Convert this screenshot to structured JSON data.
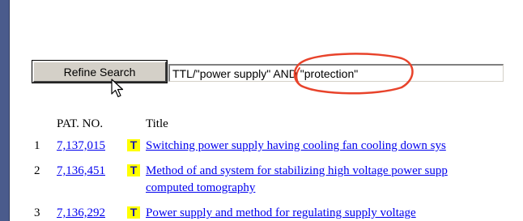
{
  "search": {
    "refine_button_label": "Refine Search",
    "query_value": "TTL/\"power supply\" AND \"protection\""
  },
  "results": {
    "headers": {
      "pat_no": "PAT. NO.",
      "title": "Title"
    },
    "rows": [
      {
        "num": "1",
        "pat_no": "7,137,015",
        "icon": "T",
        "title": "Switching power supply having cooling fan cooling down sys"
      },
      {
        "num": "2",
        "pat_no": "7,136,451",
        "icon": "T",
        "title": "Method of and system for stabilizing high voltage power supp",
        "title_continued": "computed tomography"
      },
      {
        "num": "3",
        "pat_no": "7,136,292",
        "icon": "T",
        "title": "Power supply and method for regulating supply voltage"
      }
    ]
  },
  "colors": {
    "left_bar": "#4a5b8c",
    "link": "#0000ee",
    "t_icon_bg": "#ffff00",
    "t_icon_fg": "#1a1aa6",
    "annotation": "#e8432b"
  }
}
